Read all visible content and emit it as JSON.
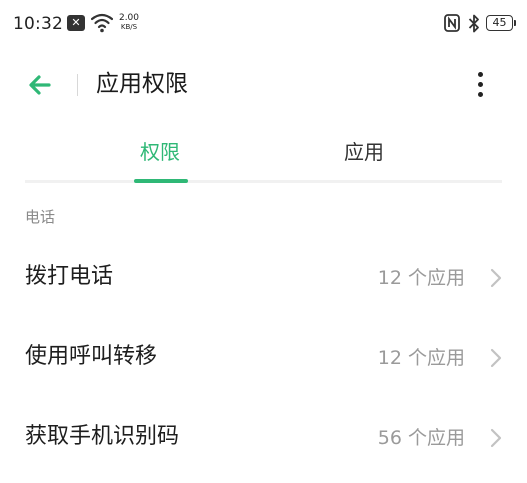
{
  "status_bar": {
    "time": "10:32",
    "notification_icon": "close-badge-icon",
    "net_speed_value": "2.00",
    "net_speed_unit": "KB/S",
    "battery_level": "45",
    "icons": [
      "wifi-icon",
      "nfc-icon",
      "bluetooth-icon",
      "battery-icon"
    ]
  },
  "header": {
    "title": "应用权限",
    "back_icon": "back-arrow-icon",
    "more_icon": "more-vertical-icon"
  },
  "tabs": [
    {
      "label": "权限",
      "selected": true
    },
    {
      "label": "应用",
      "selected": false
    }
  ],
  "section": {
    "title": "电话",
    "items": [
      {
        "label": "拨打电话",
        "count": "12 个应用"
      },
      {
        "label": "使用呼叫转移",
        "count": "12 个应用"
      },
      {
        "label": "获取手机识别码",
        "count": "56 个应用"
      }
    ]
  },
  "colors": {
    "accent": "#2fb876",
    "text_primary": "#1e1e1e",
    "text_secondary": "#9a9a9a",
    "divider": "#f1f1f1"
  }
}
